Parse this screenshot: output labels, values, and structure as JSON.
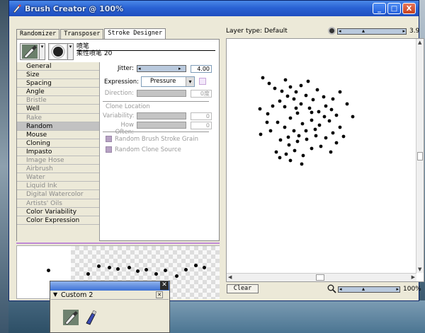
{
  "window": {
    "title": "Brush Creator @ 100%",
    "buttons": [
      "_",
      "□",
      "X"
    ]
  },
  "tabs": [
    {
      "label": "Randomizer",
      "active": false
    },
    {
      "label": "Transposer",
      "active": false
    },
    {
      "label": "Stroke Designer",
      "active": true
    }
  ],
  "variant": {
    "category_name": "喷笔",
    "variant_name": "柔性喷笔 20"
  },
  "categories": [
    {
      "label": "General",
      "enabled": true
    },
    {
      "label": "Size",
      "enabled": true
    },
    {
      "label": "Spacing",
      "enabled": true
    },
    {
      "label": "Angle",
      "enabled": true
    },
    {
      "label": "Bristle",
      "enabled": false
    },
    {
      "label": "Well",
      "enabled": true
    },
    {
      "label": "Rake",
      "enabled": false
    },
    {
      "label": "Random",
      "enabled": true,
      "selected": true
    },
    {
      "label": "Mouse",
      "enabled": true
    },
    {
      "label": "Cloning",
      "enabled": true
    },
    {
      "label": "Impasto",
      "enabled": true
    },
    {
      "label": "Image Hose",
      "enabled": false
    },
    {
      "label": "Airbrush",
      "enabled": false
    },
    {
      "label": "Water",
      "enabled": false
    },
    {
      "label": "Liquid Ink",
      "enabled": false
    },
    {
      "label": "Digital Watercolor",
      "enabled": false
    },
    {
      "label": "Artists' Oils",
      "enabled": false
    },
    {
      "label": "Color Variability",
      "enabled": true
    },
    {
      "label": "Color Expression",
      "enabled": true
    }
  ],
  "props": {
    "jitter_label": "Jitter:",
    "jitter_value": "4.00",
    "expression_label": "Expression:",
    "expression_value": "Pressure",
    "direction_label": "Direction:",
    "direction_value": "0度",
    "clone_location_label": "Clone Location",
    "variability_label": "Variability:",
    "variability_value": "0",
    "how_often_label": "How Often:",
    "how_often_value": "0",
    "random_grain_label": "Random Brush Stroke Grain",
    "random_clone_label": "Random Clone Source"
  },
  "canvas": {
    "layer_type": "Layer type: Default",
    "size_value": "3.9",
    "zoom_value": "100%",
    "clear_label": "Clear"
  },
  "custom_palette": {
    "title": "Custom  2"
  },
  "colors": {
    "titlebar": "#2a62d4",
    "selected_category": "#c2c2c2",
    "preview_divider": "#c08ad6"
  },
  "icons": [
    "brush-tool-icon",
    "dab-preview-icon",
    "size-icon",
    "zoom-icon",
    "airbrush-icon"
  ]
}
